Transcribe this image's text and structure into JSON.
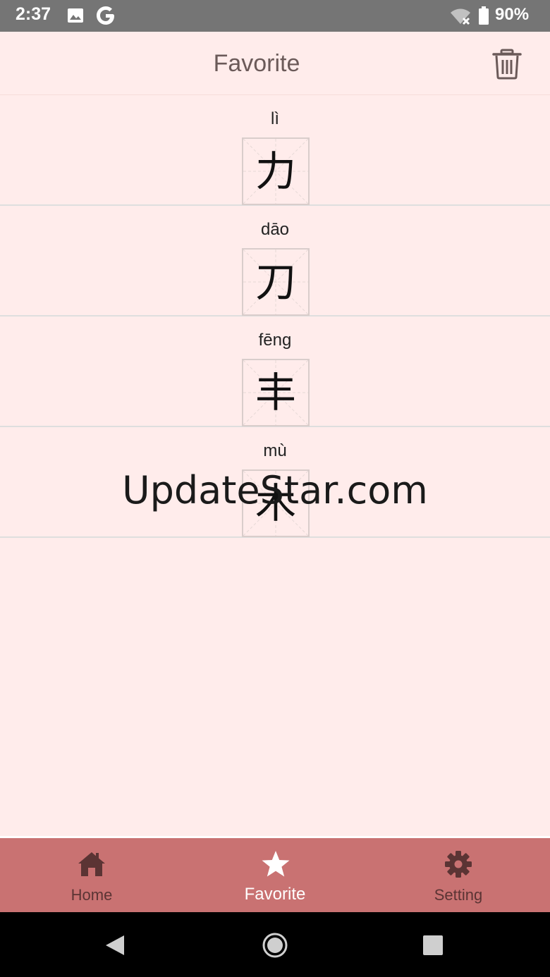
{
  "status_bar": {
    "time": "2:37",
    "battery": "90%",
    "icons": [
      "image-icon",
      "google-icon",
      "wifi-off-icon",
      "battery-icon"
    ]
  },
  "app_bar": {
    "title": "Favorite",
    "action_icon": "trash-icon"
  },
  "favorites": [
    {
      "pinyin": "lì",
      "character": "力"
    },
    {
      "pinyin": "dāo",
      "character": "刀"
    },
    {
      "pinyin": "fēng",
      "character": "丰"
    },
    {
      "pinyin": "mù",
      "character": "木"
    }
  ],
  "watermark": "UpdateStar.com",
  "bottom_nav": {
    "items": [
      {
        "label": "Home",
        "icon": "home-icon",
        "active": false
      },
      {
        "label": "Favorite",
        "icon": "star-icon",
        "active": true
      },
      {
        "label": "Setting",
        "icon": "gear-icon",
        "active": false
      }
    ]
  },
  "system_nav": {
    "icons": [
      "back-icon",
      "home-circle-icon",
      "recents-icon"
    ]
  },
  "colors": {
    "background": "#ffeceb",
    "nav_bar": "#c97272",
    "status_bar": "#757575",
    "active_nav_label": "#ffffff",
    "inactive_nav_label": "#5b3434"
  }
}
